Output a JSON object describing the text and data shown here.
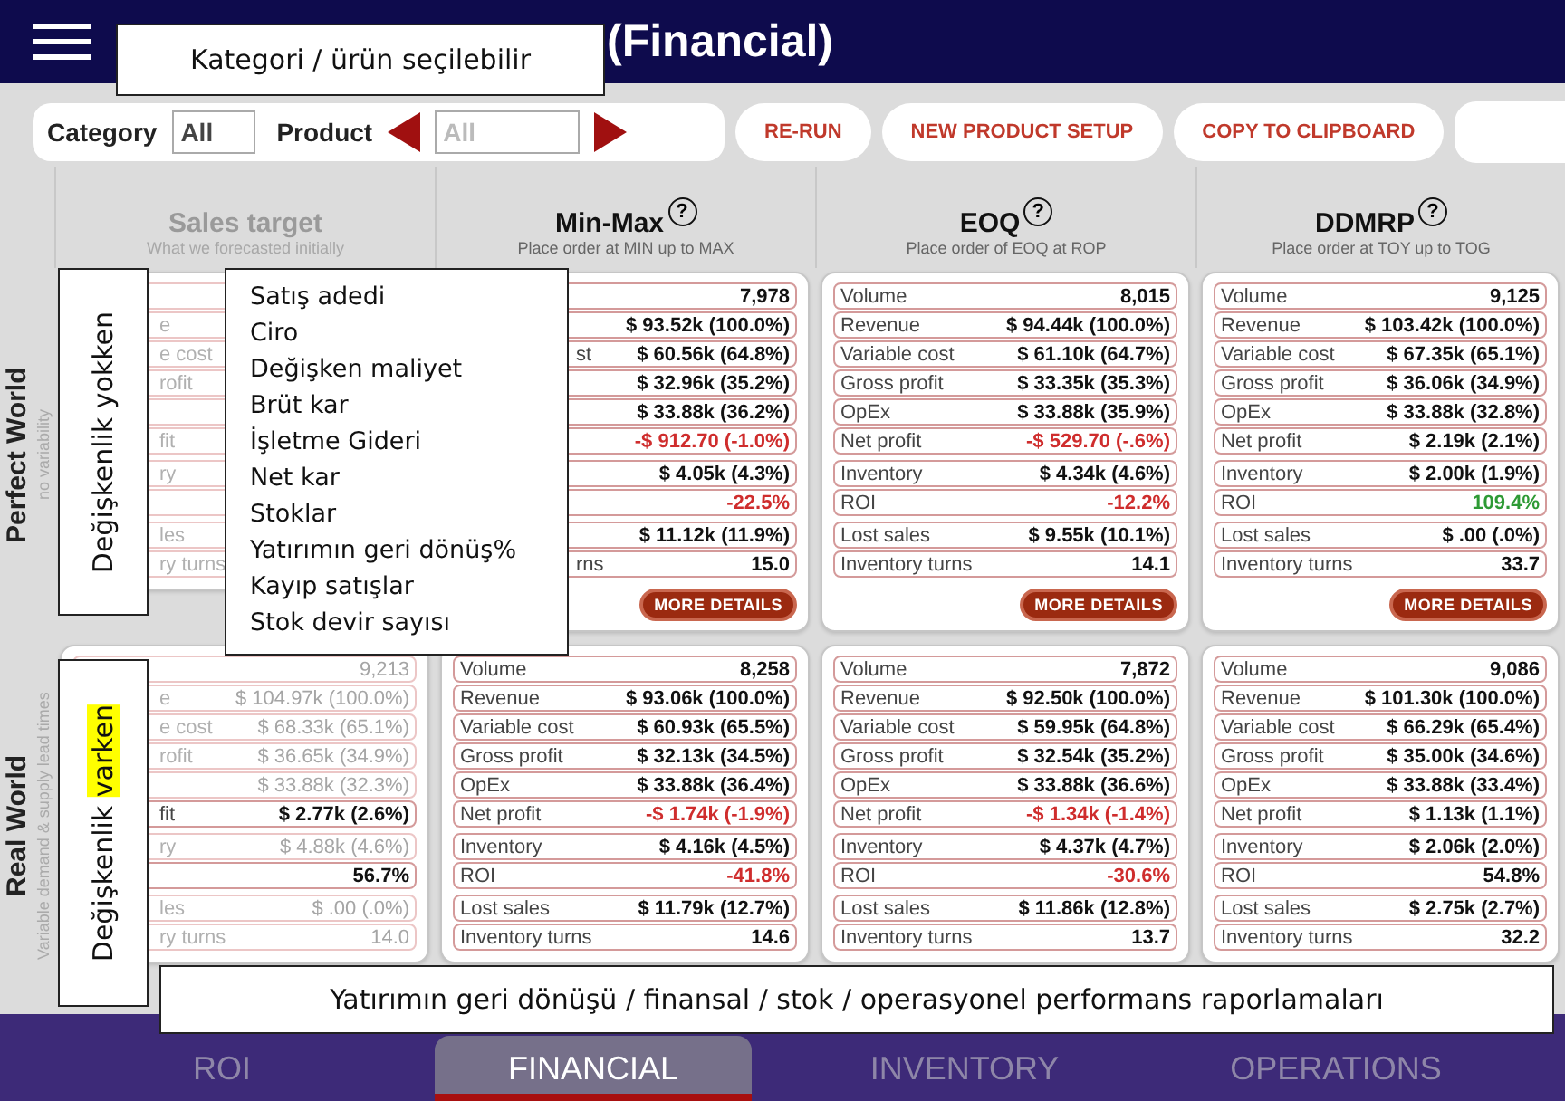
{
  "header": {
    "title": "(Financial)"
  },
  "toolbar": {
    "category_label": "Category",
    "category_value": "All",
    "product_label": "Product",
    "product_placeholder": "All",
    "buttons": [
      "RE-RUN",
      "NEW PRODUCT SETUP",
      "COPY TO CLIPBOARD"
    ]
  },
  "columns": [
    {
      "title": "Sales target",
      "subtitle": "What we forecasted initially",
      "muted": true
    },
    {
      "title": "Min-Max",
      "help": "?",
      "subtitle": "Place order at MIN up to MAX",
      "muted": false
    },
    {
      "title": "EOQ",
      "help": "?",
      "subtitle": "Place order of EOQ at ROP",
      "muted": false
    },
    {
      "title": "DDMRP",
      "help": "?",
      "subtitle": "Place order at TOY up to TOG",
      "muted": false
    }
  ],
  "scenarios": [
    {
      "title": "Perfect World",
      "subtitle": "no variability",
      "cards": [
        {
          "rows": [
            {
              "kind": "muted"
            },
            {
              "label": "e",
              "kind": "muted"
            },
            {
              "label": "e cost",
              "kind": "muted"
            },
            {
              "label": "rofit",
              "kind": "muted"
            },
            {
              "kind": "muted"
            },
            {
              "label": "fit",
              "kind": "muted"
            },
            {
              "label": "ry",
              "kind": "muted"
            },
            {
              "kind": "muted"
            },
            {
              "label": "les",
              "kind": "muted"
            },
            {
              "label": "ry turns",
              "kind": "muted"
            }
          ]
        },
        {
          "rows": [
            {
              "value": "7,978",
              "kind": "normal"
            },
            {
              "value": "$ 93.52k (100.0%)",
              "kind": "normal"
            },
            {
              "label": "st",
              "value": "$ 60.56k (64.8%)",
              "kind": "normal"
            },
            {
              "value": "$ 32.96k (35.2%)",
              "kind": "normal"
            },
            {
              "value": "$ 33.88k (36.2%)",
              "kind": "normal"
            },
            {
              "value": "-$ 912.70 (-1.0%)",
              "kind": "negative"
            },
            {
              "value": "$ 4.05k (4.3%)",
              "kind": "normal"
            },
            {
              "value": "-22.5%",
              "kind": "negative"
            },
            {
              "value": "$ 11.12k (11.9%)",
              "kind": "normal"
            },
            {
              "label": "rns",
              "value": "15.0",
              "kind": "normal"
            }
          ],
          "button": "MORE DETAILS"
        },
        {
          "rows": [
            {
              "label": "Volume",
              "value": "8,015",
              "kind": "normal"
            },
            {
              "label": "Revenue",
              "value": "$ 94.44k (100.0%)",
              "kind": "normal"
            },
            {
              "label": "Variable cost",
              "value": "$ 61.10k (64.7%)",
              "kind": "normal"
            },
            {
              "label": "Gross profit",
              "value": "$ 33.35k (35.3%)",
              "kind": "normal"
            },
            {
              "label": "OpEx",
              "value": "$ 33.88k (35.9%)",
              "kind": "normal"
            },
            {
              "label": "Net profit",
              "value": "-$ 529.70 (-.6%)",
              "kind": "negative"
            },
            {
              "label": "Inventory",
              "value": "$ 4.34k (4.6%)",
              "kind": "normal"
            },
            {
              "label": "ROI",
              "value": "-12.2%",
              "kind": "negative"
            },
            {
              "label": "Lost sales",
              "value": "$ 9.55k (10.1%)",
              "kind": "normal"
            },
            {
              "label": "Inventory turns",
              "value": "14.1",
              "kind": "normal"
            }
          ],
          "button": "MORE DETAILS"
        },
        {
          "rows": [
            {
              "label": "Volume",
              "value": "9,125",
              "kind": "normal"
            },
            {
              "label": "Revenue",
              "value": "$ 103.42k (100.0%)",
              "kind": "normal"
            },
            {
              "label": "Variable cost",
              "value": "$ 67.35k (65.1%)",
              "kind": "normal"
            },
            {
              "label": "Gross profit",
              "value": "$ 36.06k (34.9%)",
              "kind": "normal"
            },
            {
              "label": "OpEx",
              "value": "$ 33.88k (32.8%)",
              "kind": "normal"
            },
            {
              "label": "Net profit",
              "value": "$ 2.19k (2.1%)",
              "kind": "normal"
            },
            {
              "label": "Inventory",
              "value": "$ 2.00k (1.9%)",
              "kind": "normal"
            },
            {
              "label": "ROI",
              "value": "109.4%",
              "kind": "positive"
            },
            {
              "label": "Lost sales",
              "value": "$ .00 (.0%)",
              "kind": "normal"
            },
            {
              "label": "Inventory turns",
              "value": "33.7",
              "kind": "normal"
            }
          ],
          "button": "MORE DETAILS"
        }
      ]
    },
    {
      "title": "Real World",
      "subtitle": "Variable demand & supply lead times",
      "cards": [
        {
          "rows": [
            {
              "value": "9,213",
              "kind": "muted"
            },
            {
              "label": "e",
              "value": "$ 104.97k (100.0%)",
              "kind": "muted"
            },
            {
              "label": "e cost",
              "value": "$ 68.33k (65.1%)",
              "kind": "muted"
            },
            {
              "label": "rofit",
              "value": "$ 36.65k (34.9%)",
              "kind": "muted"
            },
            {
              "value": "$ 33.88k (32.3%)",
              "kind": "muted"
            },
            {
              "label": "fit",
              "value": "$ 2.77k (2.6%)",
              "kind": "normal"
            },
            {
              "label": "ry",
              "value": "$ 4.88k (4.6%)",
              "kind": "muted"
            },
            {
              "value": "56.7%",
              "kind": "normal"
            },
            {
              "label": "les",
              "value": "$ .00 (.0%)",
              "kind": "muted"
            },
            {
              "label": "ry turns",
              "value": "14.0",
              "kind": "muted"
            }
          ]
        },
        {
          "rows": [
            {
              "label": "Volume",
              "value": "8,258",
              "kind": "normal"
            },
            {
              "label": "Revenue",
              "value": "$ 93.06k (100.0%)",
              "kind": "normal"
            },
            {
              "label": "Variable cost",
              "value": "$ 60.93k (65.5%)",
              "kind": "normal"
            },
            {
              "label": "Gross profit",
              "value": "$ 32.13k (34.5%)",
              "kind": "normal"
            },
            {
              "label": "OpEx",
              "value": "$ 33.88k (36.4%)",
              "kind": "normal"
            },
            {
              "label": "Net profit",
              "value": "-$ 1.74k (-1.9%)",
              "kind": "negative"
            },
            {
              "label": "Inventory",
              "value": "$ 4.16k (4.5%)",
              "kind": "normal"
            },
            {
              "label": "ROI",
              "value": "-41.8%",
              "kind": "negative"
            },
            {
              "label": "Lost sales",
              "value": "$ 11.79k (12.7%)",
              "kind": "normal"
            },
            {
              "label": "Inventory turns",
              "value": "14.6",
              "kind": "normal"
            }
          ]
        },
        {
          "rows": [
            {
              "label": "Volume",
              "value": "7,872",
              "kind": "normal"
            },
            {
              "label": "Revenue",
              "value": "$ 92.50k (100.0%)",
              "kind": "normal"
            },
            {
              "label": "Variable cost",
              "value": "$ 59.95k (64.8%)",
              "kind": "normal"
            },
            {
              "label": "Gross profit",
              "value": "$ 32.54k (35.2%)",
              "kind": "normal"
            },
            {
              "label": "OpEx",
              "value": "$ 33.88k (36.6%)",
              "kind": "normal"
            },
            {
              "label": "Net profit",
              "value": "-$ 1.34k (-1.4%)",
              "kind": "negative"
            },
            {
              "label": "Inventory",
              "value": "$ 4.37k (4.7%)",
              "kind": "normal"
            },
            {
              "label": "ROI",
              "value": "-30.6%",
              "kind": "negative"
            },
            {
              "label": "Lost sales",
              "value": "$ 11.86k (12.8%)",
              "kind": "normal"
            },
            {
              "label": "Inventory turns",
              "value": "13.7",
              "kind": "normal"
            }
          ]
        },
        {
          "rows": [
            {
              "label": "Volume",
              "value": "9,086",
              "kind": "normal"
            },
            {
              "label": "Revenue",
              "value": "$ 101.30k (100.0%)",
              "kind": "normal"
            },
            {
              "label": "Variable cost",
              "value": "$ 66.29k (65.4%)",
              "kind": "normal"
            },
            {
              "label": "Gross profit",
              "value": "$ 35.00k (34.6%)",
              "kind": "normal"
            },
            {
              "label": "OpEx",
              "value": "$ 33.88k (33.4%)",
              "kind": "normal"
            },
            {
              "label": "Net profit",
              "value": "$ 1.13k (1.1%)",
              "kind": "normal"
            },
            {
              "label": "Inventory",
              "value": "$ 2.06k (2.0%)",
              "kind": "normal"
            },
            {
              "label": "ROI",
              "value": "54.8%",
              "kind": "normal"
            },
            {
              "label": "Lost sales",
              "value": "$ 2.75k (2.7%)",
              "kind": "normal"
            },
            {
              "label": "Inventory turns",
              "value": "32.2",
              "kind": "normal"
            }
          ]
        }
      ]
    }
  ],
  "tabs": [
    {
      "label": "ROI",
      "selected": false
    },
    {
      "label": "FINANCIAL",
      "selected": true
    },
    {
      "label": "INVENTORY",
      "selected": false
    },
    {
      "label": "OPERATIONS",
      "selected": false
    }
  ],
  "annotations": {
    "top": "Kategori / ürün seçilebilir",
    "perfect_side": {
      "text": "Değişkenlik yokken"
    },
    "metric_list": [
      "Satış adedi",
      "Ciro",
      "Değişken maliyet",
      "Brüt kar",
      "İşletme Gideri",
      "Net kar",
      "Stoklar",
      "Yatırımın geri dönüş%",
      "Kayıp satışlar",
      "Stok devir sayısı"
    ],
    "real_side": {
      "text": "Değişkenlik",
      "highlight": "varken"
    },
    "bottom": "Yatırımın geri dönüşü / finansal / stok / operasyonel performans raporlamaları"
  }
}
